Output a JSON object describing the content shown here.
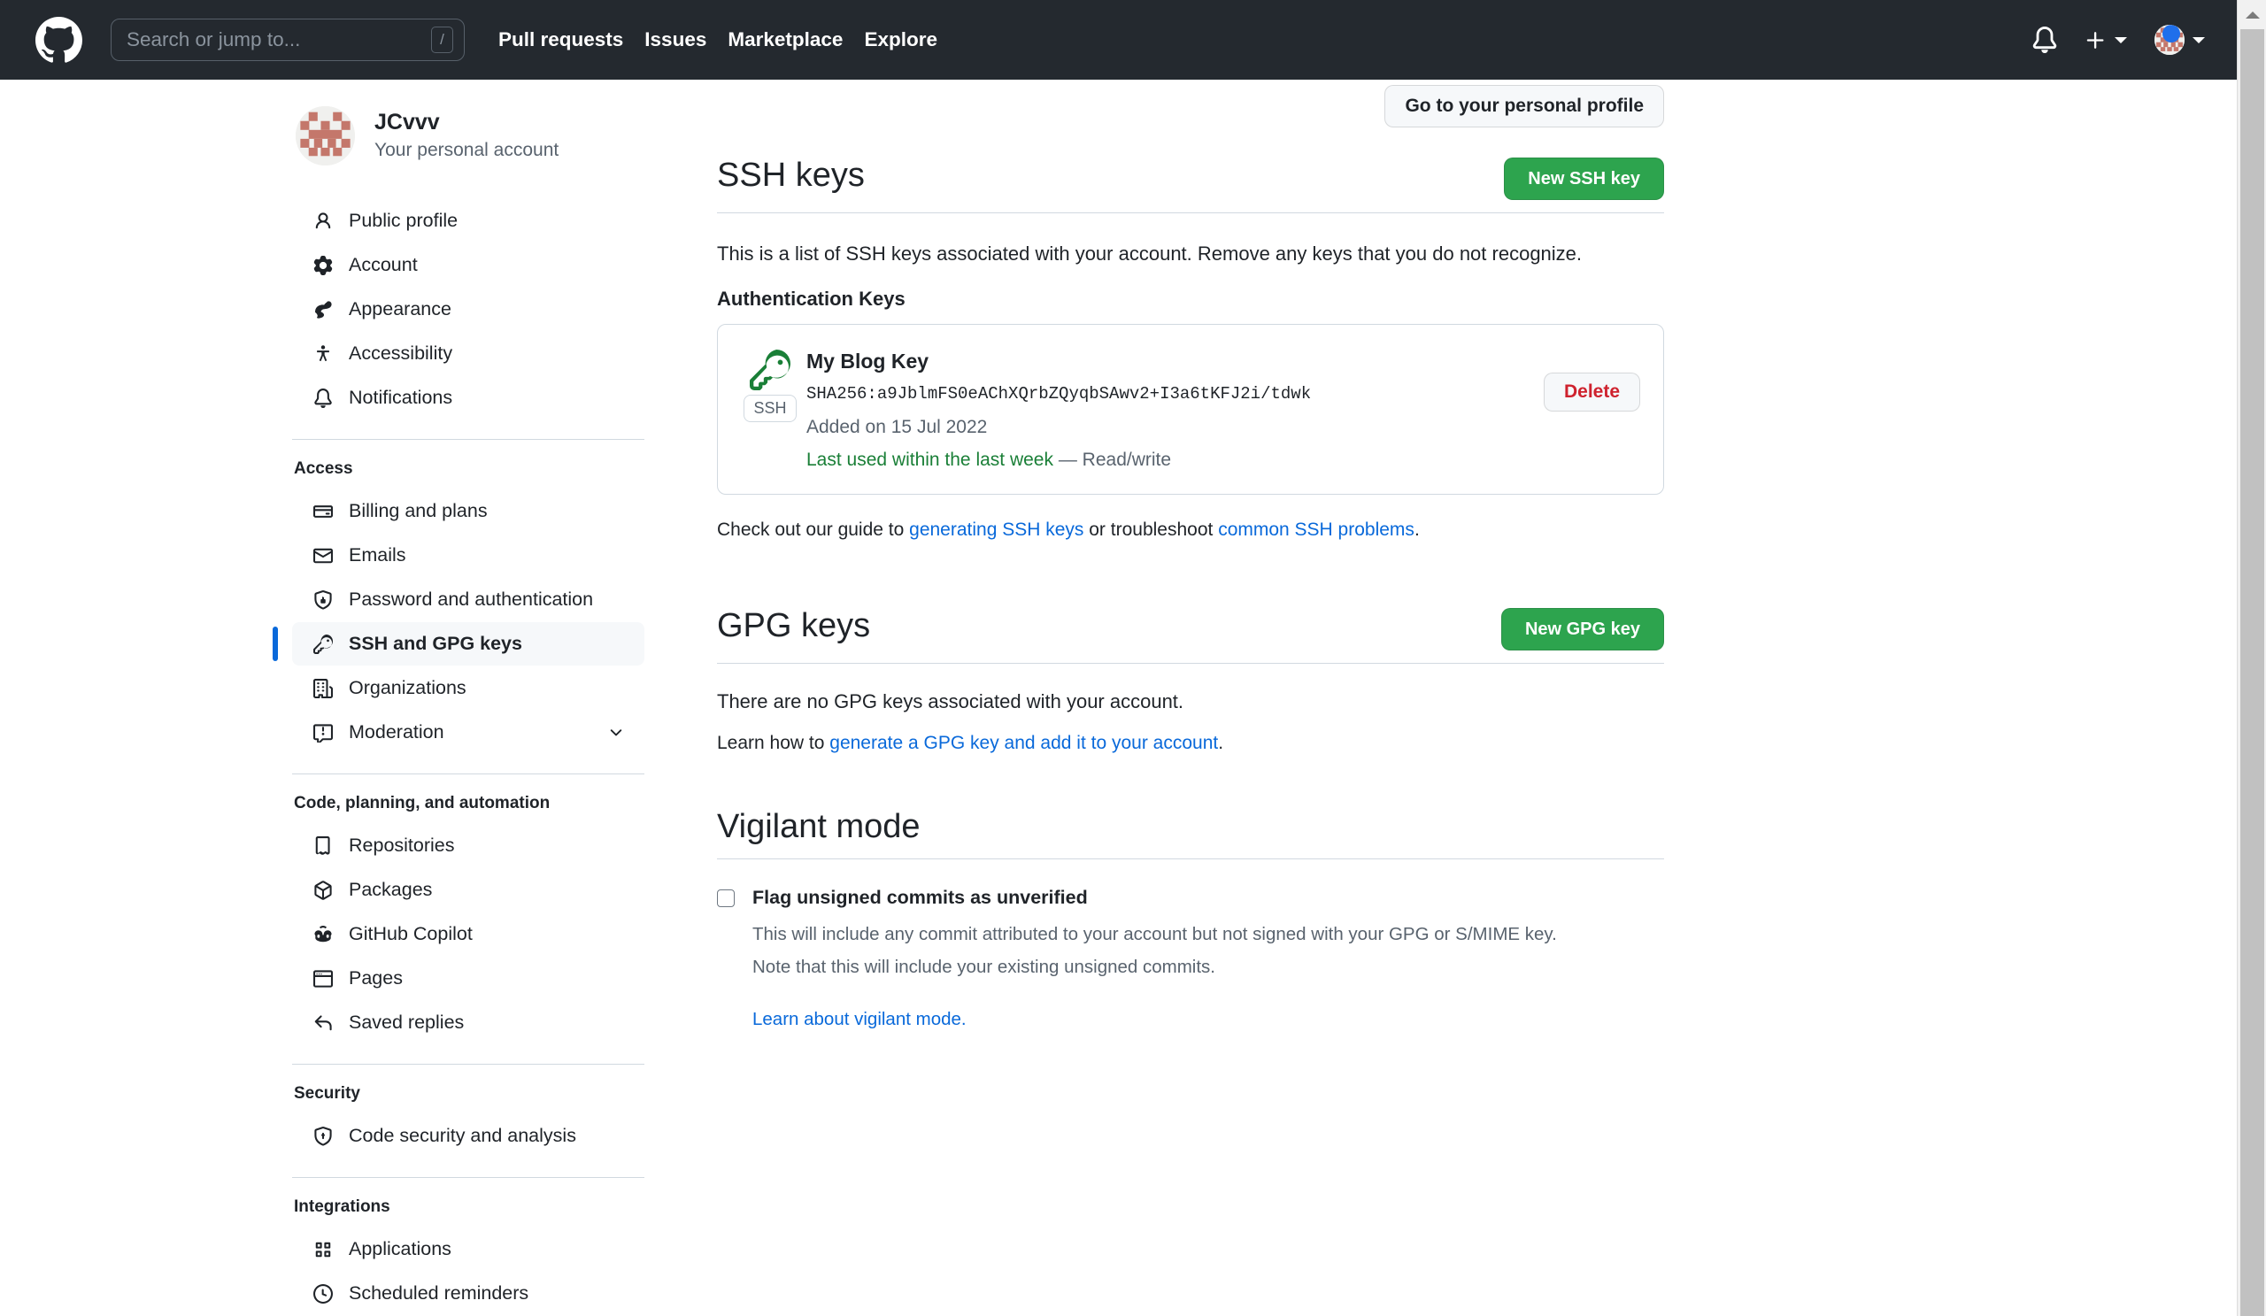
{
  "header": {
    "logo_icon": "github-mark-icon",
    "search": {
      "placeholder": "Search or jump to...",
      "shortcut": "/"
    },
    "nav": [
      {
        "label": "Pull requests"
      },
      {
        "label": "Issues"
      },
      {
        "label": "Marketplace"
      },
      {
        "label": "Explore"
      }
    ],
    "notifications_icon": "bell-icon",
    "create_new_icon": "plus-icon",
    "account_menu_icon": "avatar-caret-icon"
  },
  "profile": {
    "name": "JCvvv",
    "subtitle": "Your personal account",
    "go_to_profile_label": "Go to your personal profile"
  },
  "sidebar": {
    "primary": [
      {
        "label": "Public profile",
        "icon": "person-icon"
      },
      {
        "label": "Account",
        "icon": "gear-icon"
      },
      {
        "label": "Appearance",
        "icon": "paintbrush-icon"
      },
      {
        "label": "Accessibility",
        "icon": "accessibility-icon"
      },
      {
        "label": "Notifications",
        "icon": "bell-icon"
      }
    ],
    "groups": [
      {
        "title": "Access",
        "items": [
          {
            "label": "Billing and plans",
            "icon": "credit-card-icon",
            "active": false
          },
          {
            "label": "Emails",
            "icon": "mail-icon",
            "active": false
          },
          {
            "label": "Password and authentication",
            "icon": "shield-lock-icon",
            "active": false
          },
          {
            "label": "SSH and GPG keys",
            "icon": "key-icon",
            "active": true
          },
          {
            "label": "Organizations",
            "icon": "organization-icon",
            "active": false
          },
          {
            "label": "Moderation",
            "icon": "report-icon",
            "active": false,
            "expandable": true
          }
        ]
      },
      {
        "title": "Code, planning, and automation",
        "items": [
          {
            "label": "Repositories",
            "icon": "repo-icon",
            "active": false
          },
          {
            "label": "Packages",
            "icon": "package-icon",
            "active": false
          },
          {
            "label": "GitHub Copilot",
            "icon": "copilot-icon",
            "active": false
          },
          {
            "label": "Pages",
            "icon": "browser-icon",
            "active": false
          },
          {
            "label": "Saved replies",
            "icon": "reply-icon",
            "active": false
          }
        ]
      },
      {
        "title": "Security",
        "items": [
          {
            "label": "Code security and analysis",
            "icon": "shield-check-icon",
            "active": false
          }
        ]
      },
      {
        "title": "Integrations",
        "items": [
          {
            "label": "Applications",
            "icon": "apps-icon",
            "active": false
          },
          {
            "label": "Scheduled reminders",
            "icon": "clock-icon",
            "active": false
          }
        ]
      }
    ]
  },
  "ssh_section": {
    "title": "SSH keys",
    "new_button": "New SSH key",
    "description": "This is a list of SSH keys associated with your account. Remove any keys that you do not recognize.",
    "subheading": "Authentication Keys",
    "keys": [
      {
        "name": "My Blog Key",
        "fingerprint": "SHA256:a9JblmFS0eAChXQrbZQyqbSAwv2+I3a6tKFJ2i/tdwk",
        "added": "Added on 15 Jul 2022",
        "last_used": "Last used within the last week",
        "access": " — Read/write",
        "badge": "SSH",
        "delete_label": "Delete",
        "key_icon": "key-icon"
      }
    ],
    "guide_prefix": "Check out our guide to ",
    "guide_link1": "generating SSH keys",
    "guide_middle": " or troubleshoot ",
    "guide_link2": "common SSH problems",
    "guide_suffix": "."
  },
  "gpg_section": {
    "title": "GPG keys",
    "new_button": "New GPG key",
    "empty_text": "There are no GPG keys associated with your account.",
    "learn_prefix": "Learn how to ",
    "learn_link": "generate a GPG key and add it to your account",
    "learn_suffix": "."
  },
  "vigilant_section": {
    "title": "Vigilant mode",
    "checkbox_label": "Flag unsigned commits as unverified",
    "checked": false,
    "description_line1": "This will include any commit attributed to your account but not signed with your GPG or S/MIME key.",
    "description_line2": "Note that this will include your existing unsigned commits.",
    "learn_link": "Learn about vigilant mode."
  },
  "colors": {
    "header_bg": "#24292f",
    "accent_green": "#2da44e",
    "link_blue": "#0969da",
    "danger_red": "#cf222e",
    "success_green": "#1a7f37",
    "active_border": "#0969da"
  }
}
